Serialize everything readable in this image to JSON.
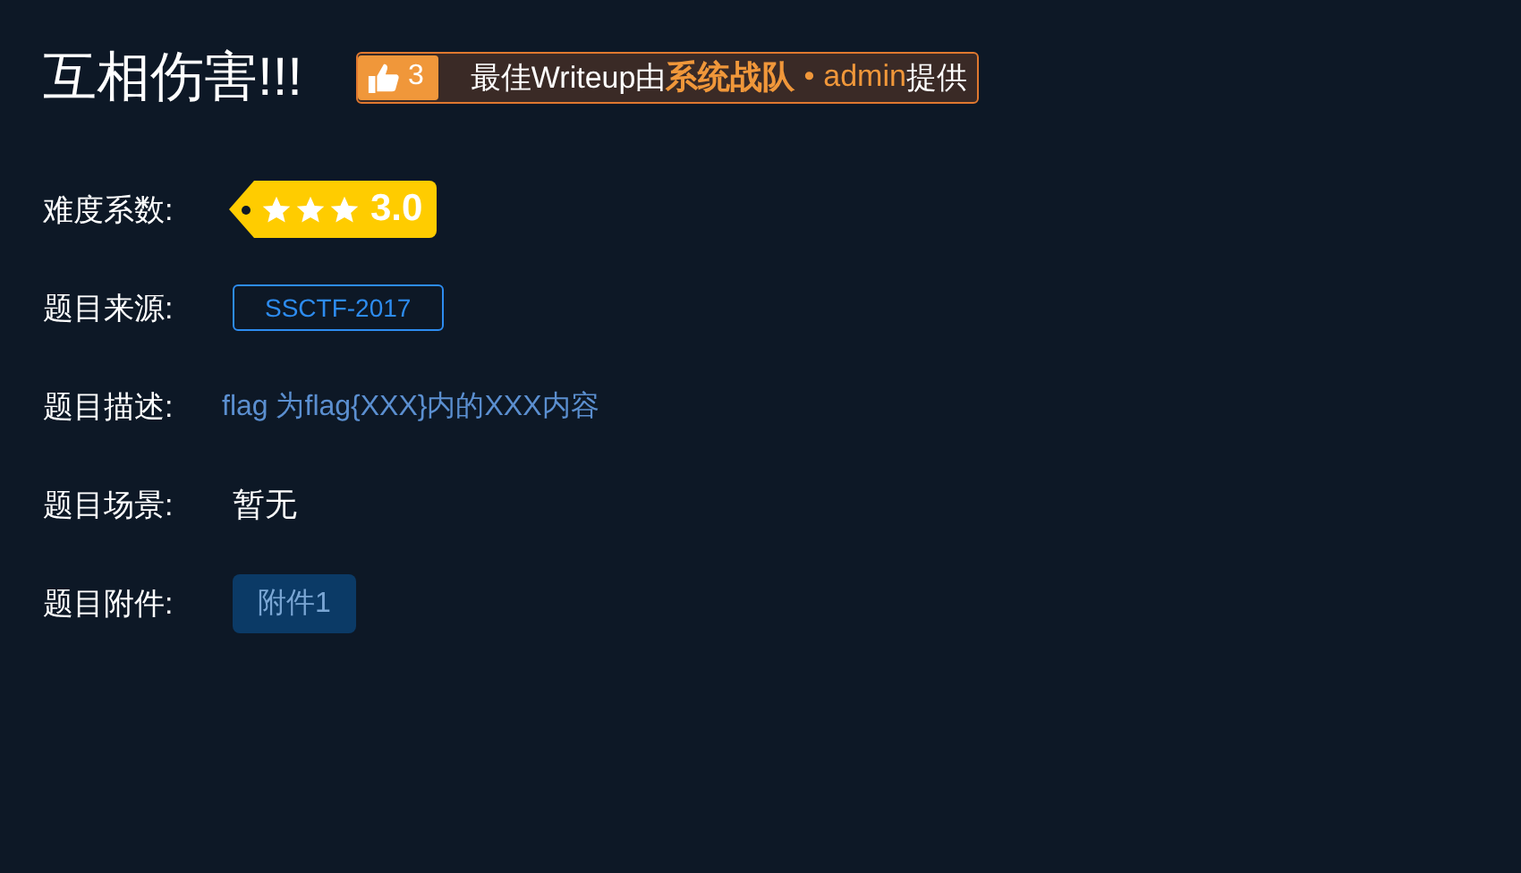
{
  "title": "互相伤害!!!",
  "writeup": {
    "likes": "3",
    "prefix": "最佳Writeup由",
    "team": "系统战队",
    "separator": "•",
    "author": "admin",
    "suffix": "提供"
  },
  "difficulty": {
    "label": "难度系数:",
    "stars": 3,
    "score": "3.0"
  },
  "fields": [
    {
      "kind": "tag",
      "label": "题目来源:",
      "value": "SSCTF-2017"
    },
    {
      "kind": "description",
      "label": "题目描述:",
      "value": "flag 为flag{XXX}内的XXX内容"
    },
    {
      "kind": "plain",
      "label": "题目场景:",
      "value": "暂无"
    },
    {
      "kind": "button",
      "label": "题目附件:",
      "value": "附件1"
    }
  ]
}
